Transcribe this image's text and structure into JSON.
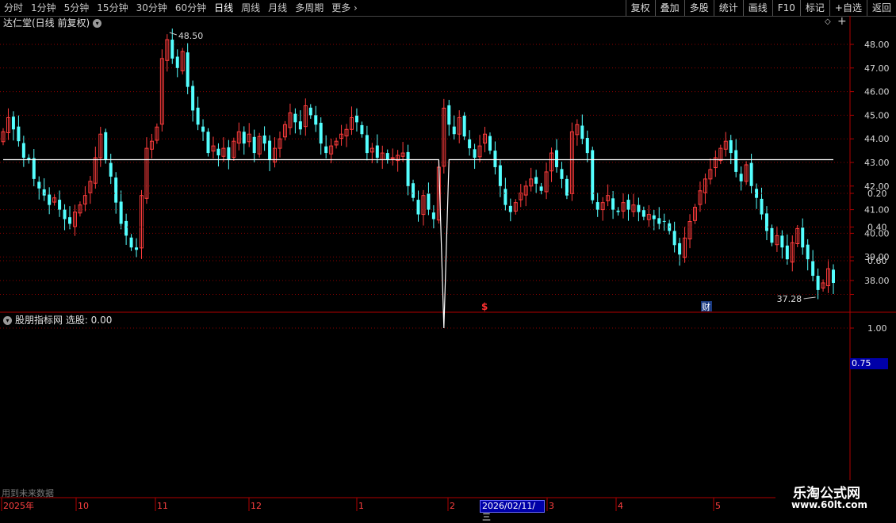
{
  "toolbar": {
    "timeframes": [
      "分时",
      "1分钟",
      "5分钟",
      "15分钟",
      "30分钟",
      "60分钟",
      "日线",
      "周线",
      "月线",
      "多周期",
      "更多"
    ],
    "active": "日线",
    "right_buttons": [
      "复权",
      "叠加",
      "多股",
      "统计",
      "画线",
      "F10",
      "标记",
      "+自选",
      "返回"
    ]
  },
  "main_chart": {
    "title": "达仁堂(日线 前复权)",
    "high_label": "48.50",
    "low_label": "37.28",
    "markers": [
      {
        "text": "$",
        "color": "#ff3030"
      },
      {
        "text": "财",
        "color": "#40a0ff"
      }
    ]
  },
  "sub_chart": {
    "title": "股朋指标网  选股: 0.00",
    "future_note": "用到未来数据",
    "crosshair_value": "0.75"
  },
  "x_axis": {
    "labels": [
      "2025年",
      "10",
      "11",
      "12",
      "1",
      "2",
      "3",
      "4",
      "5"
    ],
    "selected_date": "2026/02/11/三"
  },
  "watermark": {
    "line1": "乐淘公式网",
    "line2": "www.60lt.com"
  },
  "colors": {
    "up": "#ff3c3c",
    "down": "#54ffff",
    "grid": "#8b0000",
    "axis": "#b00000"
  },
  "chart_data": [
    {
      "type": "candlestick",
      "title": "达仁堂(日线 前复权)",
      "y_ticks": [
        38,
        39,
        40,
        41,
        42,
        43,
        44,
        45,
        46,
        47,
        48
      ],
      "ylim": [
        37.0,
        49.0
      ],
      "annotations": [
        {
          "text": "48.50",
          "value": 48.5
        },
        {
          "text": "37.28",
          "value": 37.28
        }
      ],
      "closes": [
        44.3,
        44.9,
        44.4,
        43.9,
        43.2,
        43.1,
        42.3,
        41.9,
        41.6,
        41.2,
        41.5,
        41.0,
        40.6,
        40.4,
        40.9,
        41.2,
        41.6,
        42.2,
        43.2,
        44.2,
        43.1,
        42.4,
        41.3,
        40.4,
        39.9,
        39.4,
        39.3,
        41.6,
        43.6,
        43.9,
        44.5,
        47.4,
        48.2,
        47.4,
        47.0,
        47.7,
        46.2,
        45.2,
        44.6,
        44.3,
        43.4,
        43.7,
        43.3,
        43.6,
        43.1,
        43.9,
        44.3,
        43.8,
        44.2,
        43.4,
        44.1,
        43.8,
        43.1,
        43.6,
        44.0,
        44.6,
        45.1,
        44.7,
        44.4,
        45.4,
        45.0,
        44.6,
        43.8,
        43.4,
        43.7,
        43.9,
        44.2,
        44.4,
        44.9,
        44.7,
        44.2,
        43.4,
        43.6,
        43.2,
        43.4,
        43.1,
        43.2,
        43.3,
        43.4,
        42.0,
        41.5,
        40.8,
        41.6,
        41.0,
        40.6,
        42.8,
        45.3,
        44.6,
        44.2,
        44.9,
        44.1,
        43.6,
        43.2,
        43.7,
        44.2,
        43.5,
        42.8,
        42.0,
        41.2,
        40.9,
        41.3,
        41.7,
        42.0,
        42.3,
        42.1,
        41.8,
        42.6,
        43.4,
        42.8,
        42.3,
        41.6,
        44.3,
        44.6,
        44.0,
        43.4,
        41.4,
        41.0,
        41.3,
        41.6,
        41.0,
        40.9,
        41.3,
        41.0,
        41.2,
        40.9,
        40.7,
        40.8,
        40.6,
        40.4,
        40.5,
        40.1,
        39.5,
        39.1,
        39.8,
        40.5,
        41.1,
        41.8,
        42.3,
        42.7,
        43.2,
        43.6,
        43.9,
        43.4,
        42.6,
        42.2,
        42.9,
        42.0,
        41.5,
        40.8,
        40.1,
        39.6,
        39.9,
        39.4,
        38.9,
        39.6,
        40.2,
        39.4,
        38.9,
        38.2,
        37.6,
        37.9,
        38.5,
        37.9
      ]
    },
    {
      "type": "line",
      "title": "股朋指标网  选股: 0.00",
      "y_ticks": [
        0.2,
        0.4,
        0.6,
        0.8,
        1.0
      ],
      "ylim": [
        -0.06,
        1.08
      ],
      "spike_index": 86,
      "spike_value": 1.0,
      "series": [
        {
          "values_rule": "0 everywhere except 1.0 at spike_index"
        }
      ]
    }
  ]
}
